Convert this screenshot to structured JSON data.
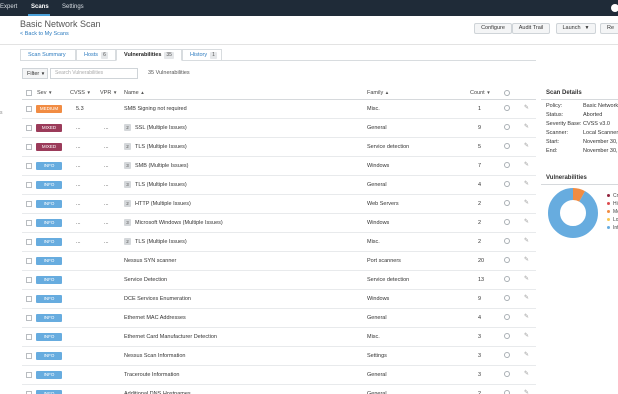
{
  "topnav": {
    "items": [
      {
        "label": "Expert"
      },
      {
        "label": "Scans"
      },
      {
        "label": "Settings"
      }
    ]
  },
  "header": {
    "title": "Basic Network Scan",
    "back_link": "< Back to My Scans",
    "buttons": {
      "configure": "Configure",
      "audit_trail": "Audit Trail",
      "launch": "Launch",
      "report": "Re"
    }
  },
  "tabs": [
    {
      "label": "Scan Summary",
      "count": ""
    },
    {
      "label": "Hosts",
      "count": "6"
    },
    {
      "label": "Vulnerabilities",
      "count": "35"
    },
    {
      "label": "History",
      "count": "1"
    }
  ],
  "filter": {
    "label": "Filter",
    "search_placeholder": "Search Vulnerabilities",
    "count_text": "35 Vulnerabilities"
  },
  "table": {
    "columns": {
      "sev": "Sev",
      "cvss": "CVSS",
      "vpr": "VPR",
      "name": "Name",
      "family": "Family",
      "count": "Count"
    },
    "rows": [
      {
        "sev": "MEDIUM",
        "cvss": "5.3",
        "vpr": "",
        "group": "",
        "name": "SMB Signing not required",
        "family": "Misc.",
        "count": "1"
      },
      {
        "sev": "MIXED",
        "cvss": "...",
        "vpr": "...",
        "group": "2",
        "name": "SSL (Multiple Issues)",
        "family": "General",
        "count": "9"
      },
      {
        "sev": "MIXED",
        "cvss": "...",
        "vpr": "...",
        "group": "2",
        "name": "TLS (Multiple Issues)",
        "family": "Service detection",
        "count": "5"
      },
      {
        "sev": "INFO",
        "cvss": "...",
        "vpr": "...",
        "group": "3",
        "name": "SMB (Multiple Issues)",
        "family": "Windows",
        "count": "7"
      },
      {
        "sev": "INFO",
        "cvss": "...",
        "vpr": "...",
        "group": "3",
        "name": "TLS (Multiple Issues)",
        "family": "General",
        "count": "4"
      },
      {
        "sev": "INFO",
        "cvss": "...",
        "vpr": "...",
        "group": "2",
        "name": "HTTP (Multiple Issues)",
        "family": "Web Servers",
        "count": "2"
      },
      {
        "sev": "INFO",
        "cvss": "...",
        "vpr": "...",
        "group": "3",
        "name": "Microsoft Windows (Multiple Issues)",
        "family": "Windows",
        "count": "2"
      },
      {
        "sev": "INFO",
        "cvss": "...",
        "vpr": "...",
        "group": "2",
        "name": "TLS (Multiple Issues)",
        "family": "Misc.",
        "count": "2"
      },
      {
        "sev": "INFO",
        "cvss": "",
        "vpr": "",
        "group": "",
        "name": "Nessus SYN scanner",
        "family": "Port scanners",
        "count": "20"
      },
      {
        "sev": "INFO",
        "cvss": "",
        "vpr": "",
        "group": "",
        "name": "Service Detection",
        "family": "Service detection",
        "count": "13"
      },
      {
        "sev": "INFO",
        "cvss": "",
        "vpr": "",
        "group": "",
        "name": "DCE Services Enumeration",
        "family": "Windows",
        "count": "9"
      },
      {
        "sev": "INFO",
        "cvss": "",
        "vpr": "",
        "group": "",
        "name": "Ethernet MAC Addresses",
        "family": "General",
        "count": "4"
      },
      {
        "sev": "INFO",
        "cvss": "",
        "vpr": "",
        "group": "",
        "name": "Ethernet Card Manufacturer Detection",
        "family": "Misc.",
        "count": "3"
      },
      {
        "sev": "INFO",
        "cvss": "",
        "vpr": "",
        "group": "",
        "name": "Nessus Scan Information",
        "family": "Settings",
        "count": "3"
      },
      {
        "sev": "INFO",
        "cvss": "",
        "vpr": "",
        "group": "",
        "name": "Traceroute Information",
        "family": "General",
        "count": "3"
      },
      {
        "sev": "INFO",
        "cvss": "",
        "vpr": "",
        "group": "",
        "name": "Additional DNS Hostnames",
        "family": "General",
        "count": "2"
      }
    ]
  },
  "sidebar": {
    "scan_details_title": "Scan Details",
    "details": [
      {
        "label": "Policy:",
        "value": "Basic Network"
      },
      {
        "label": "Status:",
        "value": "Aborted"
      },
      {
        "label": "Severity Base:",
        "value": "CVSS v3.0"
      },
      {
        "label": "Scanner:",
        "value": "Local Scanner"
      },
      {
        "label": "Start:",
        "value": "November 30,"
      },
      {
        "label": "End:",
        "value": "November 30,"
      }
    ],
    "vuln_title": "Vulnerabilities",
    "donut": {
      "slices": [
        {
          "name": "Critical",
          "value": 0,
          "color": "#91243e"
        },
        {
          "name": "High",
          "value": 0,
          "color": "#dd4b50"
        },
        {
          "name": "Medium",
          "value": 8,
          "color": "#f18c43"
        },
        {
          "name": "Low",
          "value": 0,
          "color": "#f8c851"
        },
        {
          "name": "Info",
          "value": 92,
          "color": "#67acdf"
        }
      ]
    }
  },
  "colors": {
    "medium": "#f18c43",
    "mixed": "#9b3b5a",
    "info": "#67acdf",
    "nav_bg": "#1f2b38",
    "link": "#2c7bbf"
  },
  "icons": {
    "info": "info-circle-icon",
    "edit": "pencil-icon",
    "notify": "bell-icon"
  }
}
